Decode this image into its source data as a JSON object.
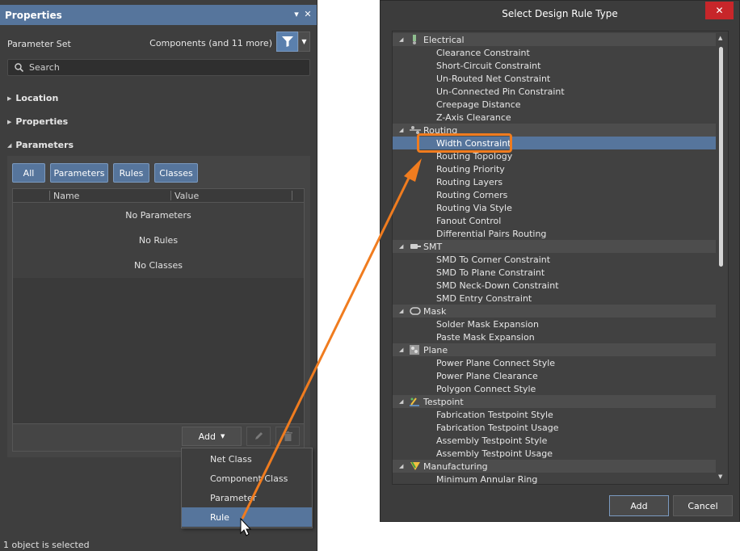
{
  "properties_panel": {
    "title": "Properties",
    "parameter_set": {
      "label": "Parameter Set",
      "value": "Components (and 11 more)"
    },
    "search": {
      "placeholder": "Search"
    },
    "sections": [
      "Location",
      "Properties",
      "Parameters"
    ],
    "tabs": [
      "All",
      "Parameters",
      "Rules",
      "Classes"
    ],
    "grid": {
      "columns": [
        "Name",
        "Value"
      ],
      "rows": [
        "No Parameters",
        "No Rules",
        "No Classes"
      ]
    },
    "add_label": "Add",
    "menu": [
      "Net Class",
      "Component Class",
      "Parameter",
      "Rule"
    ],
    "status": "1 object is selected"
  },
  "dialog": {
    "title": "Select Design Rule Type",
    "categories": [
      {
        "name": "Electrical",
        "icon": "electrical-icon",
        "items": [
          "Clearance Constraint",
          "Short-Circuit Constraint",
          "Un-Routed Net Constraint",
          "Un-Connected Pin Constraint",
          "Creepage Distance",
          "Z-Axis Clearance"
        ]
      },
      {
        "name": "Routing",
        "icon": "routing-icon",
        "items": [
          "Width Constraint",
          "Routing Topology",
          "Routing Priority",
          "Routing Layers",
          "Routing Corners",
          "Routing Via Style",
          "Fanout Control",
          "Differential Pairs Routing"
        ]
      },
      {
        "name": "SMT",
        "icon": "smt-icon",
        "items": [
          "SMD To Corner Constraint",
          "SMD To Plane Constraint",
          "SMD Neck-Down Constraint",
          "SMD Entry Constraint"
        ]
      },
      {
        "name": "Mask",
        "icon": "mask-icon",
        "items": [
          "Solder Mask Expansion",
          "Paste Mask Expansion"
        ]
      },
      {
        "name": "Plane",
        "icon": "plane-icon",
        "items": [
          "Power Plane Connect Style",
          "Power Plane Clearance",
          "Polygon Connect Style"
        ]
      },
      {
        "name": "Testpoint",
        "icon": "testpoint-icon",
        "items": [
          "Fabrication Testpoint Style",
          "Fabrication Testpoint Usage",
          "Assembly Testpoint Style",
          "Assembly Testpoint Usage"
        ]
      },
      {
        "name": "Manufacturing",
        "icon": "manufacturing-icon",
        "items": [
          "Minimum Annular Ring"
        ]
      }
    ],
    "selected_item": "Width Constraint",
    "add_label": "Add",
    "cancel_label": "Cancel"
  },
  "colors": {
    "accent": "#56759c",
    "highlight": "#f07c1f",
    "close": "#c7262a"
  }
}
